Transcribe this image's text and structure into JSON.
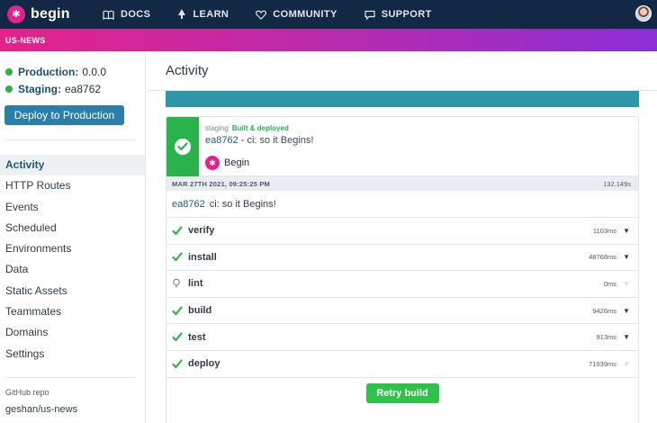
{
  "brand": {
    "name": "begin",
    "color": "#e4228a"
  },
  "topnav": {
    "links": [
      {
        "label": "DOCS",
        "icon": "book-icon"
      },
      {
        "label": "LEARN",
        "icon": "tree-icon"
      },
      {
        "label": "COMMUNITY",
        "icon": "heart-icon"
      },
      {
        "label": "SUPPORT",
        "icon": "chat-bubble-icon"
      }
    ],
    "avatar": "user-avatar"
  },
  "appbar": {
    "app_name": "US-NEWS"
  },
  "sidebar": {
    "environments": [
      {
        "label": "Production:",
        "value": "0.0.0"
      },
      {
        "label": "Staging:",
        "value": "ea8762"
      }
    ],
    "deploy_button": "Deploy to Production",
    "nav": [
      {
        "label": "Activity",
        "active": true
      },
      {
        "label": "HTTP Routes"
      },
      {
        "label": "Events"
      },
      {
        "label": "Scheduled"
      },
      {
        "label": "Environments"
      },
      {
        "label": "Data"
      },
      {
        "label": "Static Assets"
      },
      {
        "label": "Teammates"
      },
      {
        "label": "Domains"
      },
      {
        "label": "Settings"
      }
    ],
    "repo_label": "GitHub repo",
    "repo": "geshan/us-news"
  },
  "main": {
    "title": "Activity",
    "deploy": {
      "stage": "staging",
      "status": "Built & deployed",
      "hash": "ea8762",
      "separator": " - ",
      "message": "ci: so it Begins!",
      "author": "Begin"
    },
    "build": {
      "date": "MAR 27TH 2021, 09:25:25 PM",
      "duration": "132.149s",
      "commit_hash": "ea8762",
      "commit_message": "ci: so it Begins!",
      "steps": [
        {
          "name": "verify",
          "time": "1103ms",
          "status": "success",
          "expandable": true
        },
        {
          "name": "install",
          "time": "48768ms",
          "status": "success",
          "expandable": true
        },
        {
          "name": "lint",
          "time": "0ms",
          "status": "skipped",
          "expandable": false
        },
        {
          "name": "build",
          "time": "9426ms",
          "status": "success",
          "expandable": true
        },
        {
          "name": "test",
          "time": "913ms",
          "status": "success",
          "expandable": true
        },
        {
          "name": "deploy",
          "time": "71939ms",
          "status": "success",
          "expandable": false
        }
      ]
    },
    "retry_button": "Retry build"
  },
  "colors": {
    "nav_bg": "#122845",
    "success": "#2ab24c",
    "accent": "#2a7fa8",
    "teal": "#2d97a8"
  }
}
